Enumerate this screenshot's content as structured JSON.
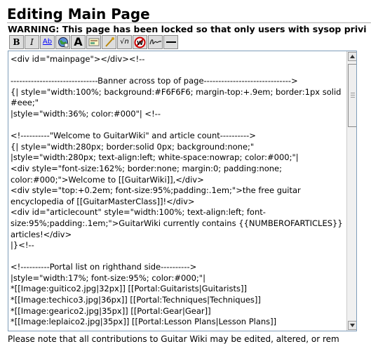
{
  "page": {
    "title": "Editing Main Page",
    "warning": "WARNING: This page has been locked so that only users with sysop privi"
  },
  "toolbar": {
    "buttons": [
      {
        "name": "bold-button",
        "label": "B",
        "icon": "bold-icon"
      },
      {
        "name": "italic-button",
        "label": "I",
        "icon": "italic-icon"
      },
      {
        "name": "internal-link-button",
        "label": "Ab",
        "icon": "link-icon"
      },
      {
        "name": "external-link-button",
        "label": "",
        "icon": "globe-link-icon"
      },
      {
        "name": "headline-button",
        "label": "A",
        "icon": "headline-icon"
      },
      {
        "name": "image-button",
        "label": "",
        "icon": "image-icon"
      },
      {
        "name": "media-button",
        "label": "",
        "icon": "media-icon"
      },
      {
        "name": "math-button",
        "label": "√n",
        "icon": "math-icon"
      },
      {
        "name": "nowiki-button",
        "label": "W",
        "icon": "nowiki-icon"
      },
      {
        "name": "signature-button",
        "label": "",
        "icon": "signature-icon"
      },
      {
        "name": "horizontal-line-button",
        "label": "",
        "icon": "horizontal-line-icon"
      }
    ]
  },
  "editor": {
    "content": "<div id=\"mainpage\"></div><!--\n\n------------------------------Banner across top of page------------------------------>\n{| style=\"width:100%; background:#F6F6F6; margin-top:+.9em; border:1px solid #eee;\"\n|style=\"width:36%; color:#000\"| <!--\n\n<!----------\"Welcome to GuitarWiki\" and article count---------->\n{| style=\"width:280px; border:solid 0px; background:none;\"\n|style=\"width:280px; text-align:left; white-space:nowrap; color:#000;\"|\n<div style=\"font-size:162%; border:none; margin:0; padding:none; color:#000;\">Welcome to [[GuitarWiki]],</div>\n<div style=\"top:+0.2em; font-size:95%;padding:.1em;\">the free guitar encyclopedia of [[GuitarMasterClass]]!</div>\n<div id=\"articlecount\" style=\"width:100%; text-align:left; font-size:95%;padding:.1em;\">GuitarWiki currently contains {{NUMBEROFARTICLES}} articles!</div>\n|}<!--\n\n<!----------Portal list on righthand side---------->\n|style=\"width:17%; font-size:95%; color:#000;\"|\n*[[Image:guitico2.jpg|32px]] [[Portal:Guitarists|Guitarists]]\n*[[Image:techico3.jpg|36px]] [[Portal:Techniques|Techniques]]\n*[[Image:gearico2.jpg|35px]] [[Portal:Gear|Gear]]\n*[[Image:leplaico2.jpg|35px]] [[Portal:Lesson Plans|Lesson Plans]]"
  },
  "footer": {
    "note": "Please note that all contributions to Guitar Wiki may be edited, altered, or rem"
  }
}
